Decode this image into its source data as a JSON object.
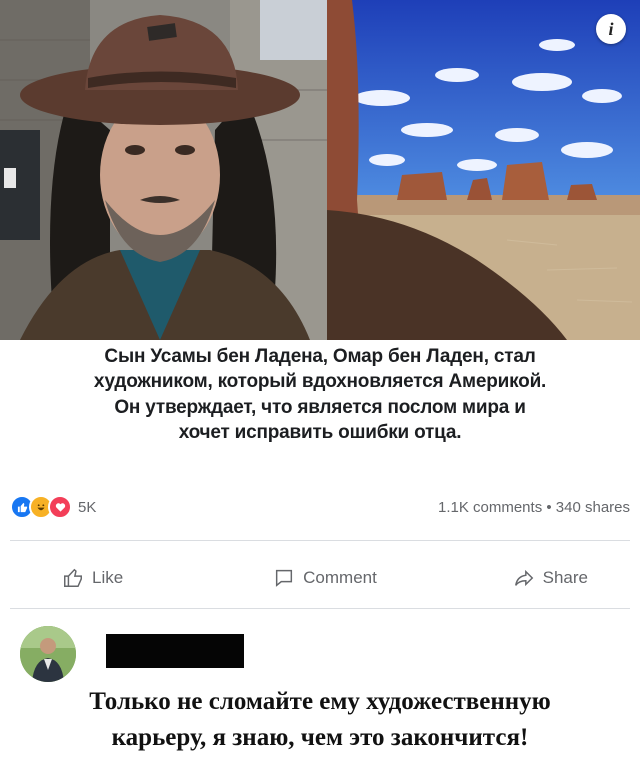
{
  "post": {
    "caption_lines": [
      "Сын Усамы бен Ладена, Омар бен Ладен, стал",
      "художником, который вдохновляется Америкой.",
      "Он утверждает, что является послом мира и",
      "хочет исправить ошибки отца."
    ],
    "info_badge": "i",
    "reaction_icons": [
      "like-icon",
      "haha-icon",
      "love-icon"
    ],
    "reaction_count": "5K",
    "stats": "1.1K comments • 340 shares"
  },
  "actions": {
    "like_label": "Like",
    "comment_label": "Comment",
    "share_label": "Share"
  },
  "comment": {
    "text_lines": [
      "Только не сломайте ему художественную",
      "карьеру, я знаю, чем это закончится!"
    ]
  },
  "colors": {
    "like_blue": "#1877f2",
    "haha_yellow": "#f7b125",
    "love_red": "#f33e58",
    "text_gray": "#65676b",
    "divider": "#dadde1"
  }
}
